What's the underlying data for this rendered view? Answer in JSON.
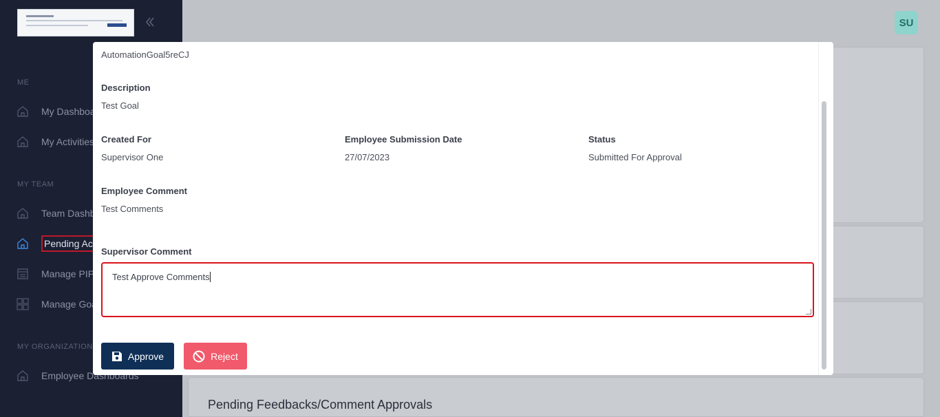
{
  "sidebar": {
    "sections": [
      {
        "title": "ME"
      },
      {
        "title": "MY TEAM"
      },
      {
        "title": "MY ORGANIZATION"
      }
    ],
    "items": [
      {
        "label": "My Dashboard",
        "icon": "home-icon"
      },
      {
        "label": "My Activities",
        "icon": "home-icon"
      },
      {
        "label": "Team Dashboard",
        "icon": "home-icon"
      },
      {
        "label": "Pending Actions",
        "icon": "home-icon"
      },
      {
        "label": "Manage PIP",
        "icon": "clipboard-icon"
      },
      {
        "label": "Manage Goals",
        "icon": "grid-icon"
      },
      {
        "label": "Employee Dashboards",
        "icon": "home-icon"
      }
    ]
  },
  "header": {
    "avatar_initials": "SU"
  },
  "background": {
    "section_heading": "Pending Feedbacks/Comment Approvals"
  },
  "modal": {
    "goal_name": "AutomationGoal5reCJ",
    "description_label": "Description",
    "description_value": "Test Goal",
    "created_for_label": "Created For",
    "created_for_value": "Supervisor One",
    "submission_date_label": "Employee Submission Date",
    "submission_date_value": "27/07/2023",
    "status_label": "Status",
    "status_value": "Submitted For Approval",
    "employee_comment_label": "Employee Comment",
    "employee_comment_value": "Test Comments",
    "supervisor_comment_label": "Supervisor Comment",
    "supervisor_comment_value": "Test Approve Comments",
    "approve_label": "Approve",
    "reject_label": "Reject"
  },
  "colors": {
    "sidebar_bg": "#1b2033",
    "approve": "#0f2f57",
    "reject": "#f15a6a",
    "focus_border": "#d9141c"
  }
}
